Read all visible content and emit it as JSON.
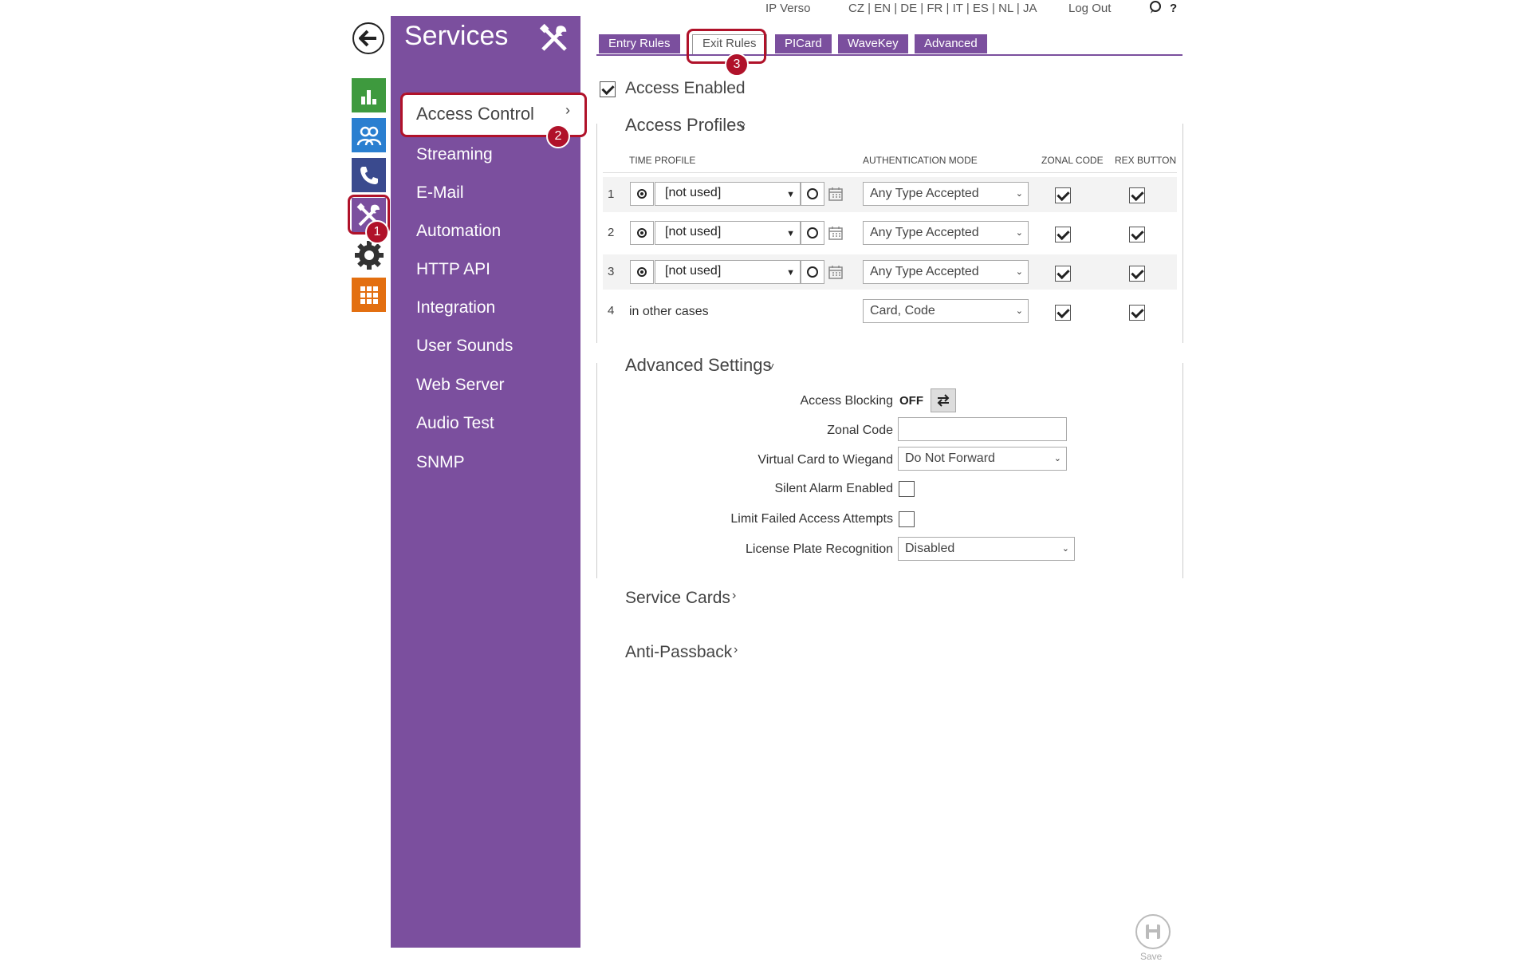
{
  "topbar": {
    "device": "IP Verso",
    "languages": "CZ | EN | DE | FR | IT | ES | NL | JA",
    "logout": "Log Out",
    "help": "?"
  },
  "menu": {
    "title": "Services",
    "active": "Access Control",
    "items": [
      "Streaming",
      "E-Mail",
      "Automation",
      "HTTP API",
      "Integration",
      "User Sounds",
      "Web Server",
      "Audio Test",
      "SNMP"
    ]
  },
  "badges": [
    "1",
    "2",
    "3"
  ],
  "tabs": [
    {
      "label": "Entry Rules",
      "active": false
    },
    {
      "label": "Exit Rules",
      "active": true
    },
    {
      "label": "PICard",
      "active": false
    },
    {
      "label": "WaveKey",
      "active": false
    },
    {
      "label": "Advanced",
      "active": false
    }
  ],
  "access_enabled": {
    "label": "Access Enabled",
    "checked": true
  },
  "access_profiles": {
    "title": "Access Profiles",
    "columns": {
      "time_profile": "TIME PROFILE",
      "auth_mode": "AUTHENTICATION MODE",
      "zonal_code": "ZONAL CODE",
      "rex_button": "REX BUTTON"
    },
    "rows": [
      {
        "num": "1",
        "profile": "[not used]",
        "auth": "Any Type Accepted",
        "zonal": true,
        "rex": true
      },
      {
        "num": "2",
        "profile": "[not used]",
        "auth": "Any Type Accepted",
        "zonal": true,
        "rex": true
      },
      {
        "num": "3",
        "profile": "[not used]",
        "auth": "Any Type Accepted",
        "zonal": true,
        "rex": true
      },
      {
        "num": "4",
        "profile": "in other cases",
        "auth": "Card, Code",
        "zonal": true,
        "rex": true
      }
    ]
  },
  "advanced_settings": {
    "title": "Advanced Settings",
    "access_blocking": {
      "label": "Access Blocking",
      "value": "OFF"
    },
    "zonal_code": {
      "label": "Zonal Code",
      "value": ""
    },
    "virtual_card": {
      "label": "Virtual Card to Wiegand",
      "value": "Do Not Forward"
    },
    "silent_alarm": {
      "label": "Silent Alarm Enabled",
      "checked": false
    },
    "limit_failed": {
      "label": "Limit Failed Access Attempts",
      "checked": false
    },
    "lpr": {
      "label": "License Plate Recognition",
      "value": "Disabled"
    }
  },
  "service_cards": {
    "title": "Service Cards"
  },
  "anti_passback": {
    "title": "Anti-Passback"
  },
  "save": {
    "label": "Save"
  },
  "colors": {
    "purple": "#7b4f9e",
    "highlight": "#b0122a",
    "green": "#3e9a3e",
    "blue": "#2a7fd0",
    "navy": "#3a4a8e",
    "orange": "#e36f10",
    "dark": "#333333"
  }
}
